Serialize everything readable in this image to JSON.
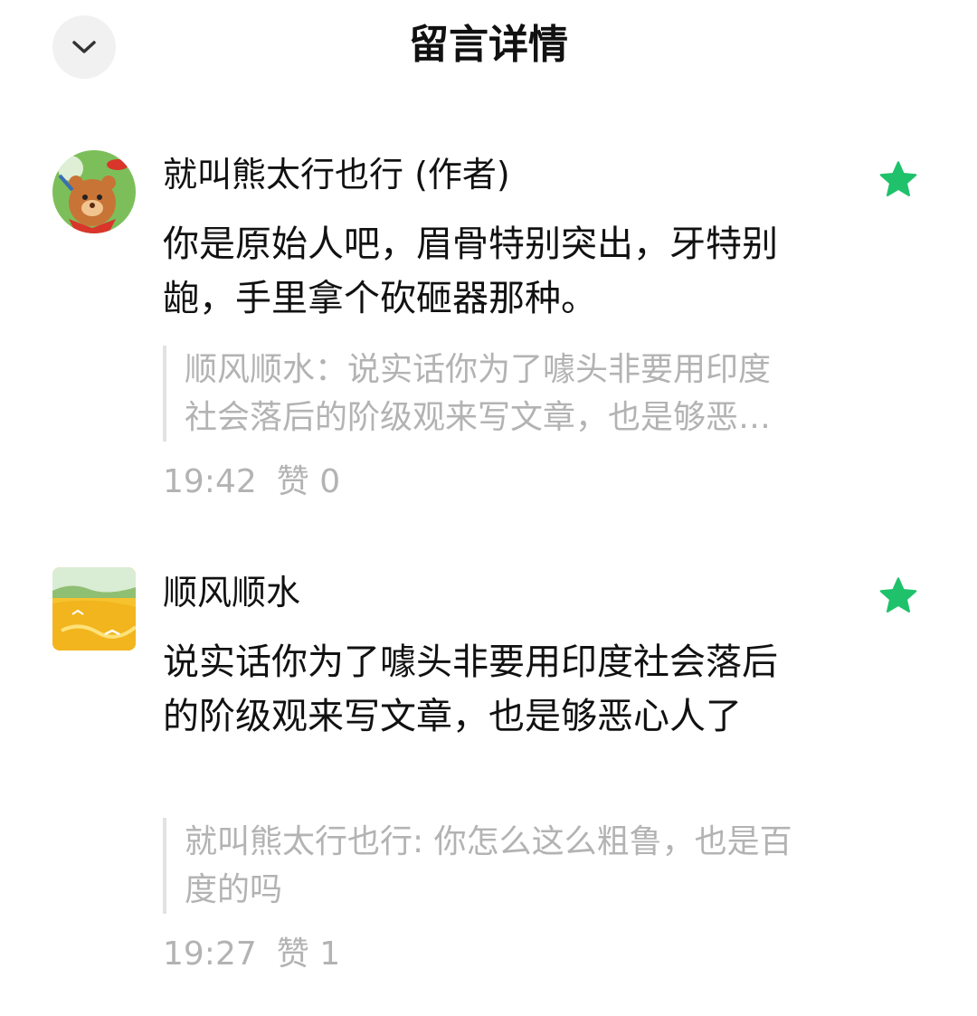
{
  "header": {
    "title": "留言详情",
    "back_icon": "chevron-down-icon"
  },
  "colors": {
    "accent_star": "#1fc26b",
    "secondary_text": "#b3b3b3"
  },
  "comments": [
    {
      "username": "就叫熊太行也行 (作者)",
      "avatar": "cartoon-bear-avatar",
      "starred": true,
      "content": "你是原始人吧，眉骨特别突出，牙特别龅，手里拿个砍砸器那种。",
      "quote": "顺风顺水：说实话你为了噱头非要用印度社会落后的阶级观来写文章，也是够恶心人了",
      "time": "19:42",
      "likes": "赞 0"
    },
    {
      "username": "顺风顺水",
      "avatar": "landscape-avatar",
      "starred": true,
      "content": "说实话你为了噱头非要用印度社会落后的阶级观来写文章，也是够恶心人了",
      "quote": "就叫熊太行也行: 你怎么这么粗鲁，也是百度的吗",
      "time": "19:27",
      "likes": "赞 1"
    }
  ]
}
